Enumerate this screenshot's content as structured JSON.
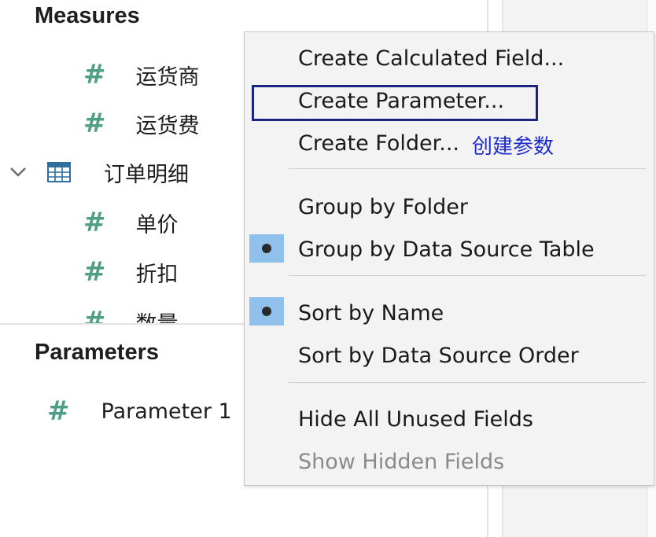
{
  "data_panel": {
    "measures": {
      "title": "Measures",
      "items": [
        {
          "label": "运货商",
          "icon": "#"
        },
        {
          "label": "运货费",
          "icon": "#"
        }
      ]
    },
    "table_group": {
      "label": "订单明细",
      "expanded": true
    },
    "table_items": [
      {
        "label": "单价",
        "icon": "#"
      },
      {
        "label": "折扣",
        "icon": "#"
      },
      {
        "label": "数量",
        "icon": "#"
      }
    ],
    "parameters": {
      "title": "Parameters",
      "items": [
        {
          "label": "Parameter 1",
          "icon": "#"
        }
      ]
    }
  },
  "context_menu": {
    "items": [
      {
        "label": "Create Calculated Field..."
      },
      {
        "label": "Create Parameter..."
      },
      {
        "label": "Create Folder..."
      },
      {
        "label": "Group by Folder"
      },
      {
        "label": "Group by Data Source Table",
        "checked": true
      },
      {
        "label": "Sort by Name",
        "checked": true
      },
      {
        "label": "Sort by Data Source Order"
      },
      {
        "label": "Hide All Unused Fields"
      },
      {
        "label": "Show Hidden Fields",
        "disabled": true
      }
    ]
  },
  "annotation": {
    "text": "创建参数"
  },
  "colors": {
    "measure_icon": "#4e9f86",
    "menu_bg": "#f3f3f3",
    "check_bg": "#8fc1ec",
    "highlight_border": "#1a237e",
    "annotation_text": "#1e2bd0"
  }
}
